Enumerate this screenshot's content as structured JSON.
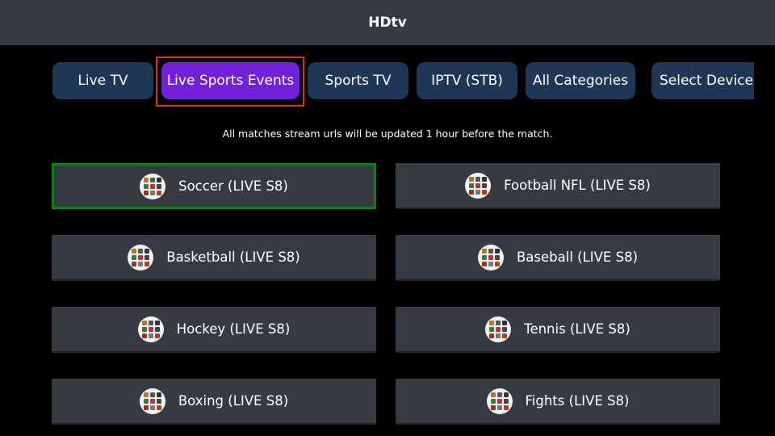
{
  "header": {
    "title": "HDtv"
  },
  "tabs": [
    {
      "label": "Live TV",
      "active": false
    },
    {
      "label": "Live Sports Events",
      "active": true
    },
    {
      "label": "Sports TV",
      "active": false
    },
    {
      "label": "IPTV (STB)",
      "active": false
    },
    {
      "label": "All Categories",
      "active": false
    },
    {
      "label": "Select Device Type",
      "active": false
    }
  ],
  "notice": "All matches stream urls will be updated 1 hour before the match.",
  "categories": [
    {
      "label": "Soccer (LIVE S8)",
      "icon": "sports-collage-icon",
      "selected": true
    },
    {
      "label": "Football NFL (LIVE S8)",
      "icon": "sports-collage-icon",
      "selected": false
    },
    {
      "label": "Basketball (LIVE S8)",
      "icon": "sports-collage-icon",
      "selected": false
    },
    {
      "label": "Baseball (LIVE S8)",
      "icon": "sports-collage-icon",
      "selected": false
    },
    {
      "label": "Hockey (LIVE S8)",
      "icon": "sports-collage-icon",
      "selected": false
    },
    {
      "label": "Tennis (LIVE S8)",
      "icon": "sports-collage-icon",
      "selected": false
    },
    {
      "label": "Boxing (LIVE S8)",
      "icon": "sports-collage-icon",
      "selected": false
    },
    {
      "label": "Fights (LIVE S8)",
      "icon": "sports-collage-icon",
      "selected": false
    }
  ],
  "colors": {
    "tab_bg": "#1f3657",
    "tab_active_bg": "#7221d8",
    "focus_ring": "#e0301e",
    "selected_border": "#0d7f14",
    "card_bg": "#363a42"
  }
}
